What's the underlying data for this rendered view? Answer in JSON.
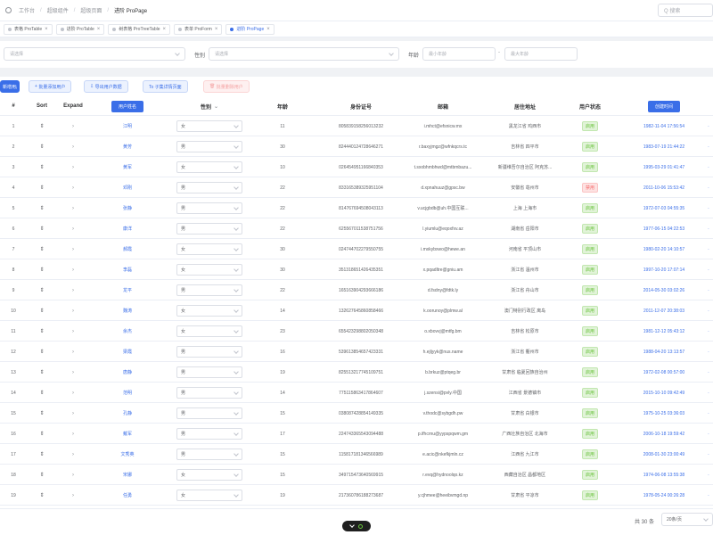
{
  "breadcrumb": {
    "items": [
      "工作台",
      "超级组件",
      "超级页面",
      "进阶 ProPage"
    ]
  },
  "search": {
    "placeholder": "Q 搜索"
  },
  "tabs": [
    {
      "label": "表格 ProTable",
      "active": false
    },
    {
      "label": "进阶 ProTable",
      "active": false
    },
    {
      "label": "树表格 ProTreeTable",
      "active": false
    },
    {
      "label": "表单 ProForm",
      "active": false
    },
    {
      "label": "进阶 ProPage",
      "active": true
    }
  ],
  "filter": {
    "f1_placeholder": "请选择",
    "gender_label": "性别",
    "gender_placeholder": "请选择",
    "age_label": "年龄",
    "age_min_placeholder": "最小年龄",
    "age_max_placeholder": "最大年龄"
  },
  "toolbar": {
    "add": "新增用户",
    "batch_add": "批量添加用户",
    "export": "导出用户数据",
    "detail": "To 子集详情页面",
    "batch_delete": "批量删除用户"
  },
  "table": {
    "headers": {
      "index": "#",
      "sort": "Sort",
      "expand": "Expand",
      "username": "用户姓名",
      "gender": "性别",
      "age": "年龄",
      "idcard": "身份证号",
      "email": "邮箱",
      "address": "居住地址",
      "status": "用户状态",
      "created": "创建时间"
    },
    "rows": [
      {
        "idx": "1",
        "name": "江明",
        "gender": "女",
        "age": "11",
        "id": "805839158256013232",
        "email": "i.mhct@efsnicw.mx",
        "addr": "黑龙江省 鸡西市",
        "status": "启用",
        "date": "1982-11-04 17:56:54"
      },
      {
        "idx": "2",
        "name": "黄芳",
        "gender": "男",
        "age": "30",
        "id": "824440124728646271",
        "email": "r.baxyjmgz@wfnkqcrs.tc",
        "addr": "吉林省 四平市",
        "status": "启用",
        "date": "1983-07-19 21:44:22"
      },
      {
        "idx": "3",
        "name": "黄军",
        "gender": "女",
        "age": "10",
        "id": "026454951166840353",
        "email": "t.sxobhmbhwd@mtbmbazu...",
        "addr": "新疆维吾尔自治区 阿克苏...",
        "status": "启用",
        "date": "1995-03-29 01:41:47"
      },
      {
        "idx": "4",
        "name": "邓刚",
        "gender": "男",
        "age": "22",
        "id": "833165389325951104",
        "email": "d.xpnahuuz@gpsc.bw",
        "addr": "安徽省 亳州市",
        "status": "禁用",
        "date": "2011-10-06 15:53:42"
      },
      {
        "idx": "5",
        "name": "张静",
        "gender": "男",
        "age": "22",
        "id": "814767694508043113",
        "email": "v.ucjgbdb@uh.中国互联...",
        "addr": "上海 上海市",
        "status": "启用",
        "date": "1972-07-03 04:55:35"
      },
      {
        "idx": "6",
        "name": "康洋",
        "gender": "男",
        "age": "22",
        "id": "625567011538751756",
        "email": "l.yiumlu@eqoxfxv.az",
        "addr": "湖南省 岳阳市",
        "status": "启用",
        "date": "1977-06-15 04:22:53"
      },
      {
        "idx": "7",
        "name": "郝霞",
        "gender": "女",
        "age": "30",
        "id": "024744702279550755",
        "email": "i.mxkybxwo@hewe.an",
        "addr": "河南省 平顶山市",
        "status": "启用",
        "date": "1980-02-20 14:10:57"
      },
      {
        "idx": "8",
        "name": "李磊",
        "gender": "女",
        "age": "30",
        "id": "351318651426435351",
        "email": "x.pqadltre@gniu.am",
        "addr": "浙江省 温州市",
        "status": "启用",
        "date": "1997-10-20 17:07:14"
      },
      {
        "idx": "9",
        "name": "龙平",
        "gender": "男",
        "age": "22",
        "id": "165163904293666186",
        "email": "d.fsdny@fdtk.ly",
        "addr": "浙江省 舟山市",
        "status": "启用",
        "date": "2014-05-30 03:02:26"
      },
      {
        "idx": "10",
        "name": "魏涛",
        "gender": "女",
        "age": "14",
        "id": "132627645860858466",
        "email": "k.oorunoy@plmw.al",
        "addr": "澳门特别行政区 离岛",
        "status": "启用",
        "date": "2011-12-07 20:38:03"
      },
      {
        "idx": "11",
        "name": "余杰",
        "gender": "女",
        "age": "23",
        "id": "655423298802050348",
        "email": "o.xbovvj@mtfg.bm",
        "addr": "吉林省 松原市",
        "status": "启用",
        "date": "1981-12-12 05:43:12"
      },
      {
        "idx": "12",
        "name": "梁霞",
        "gender": "男",
        "age": "16",
        "id": "539613854657423331",
        "email": "h.ejljyyk@nus.name",
        "addr": "浙江省 衢州市",
        "status": "启用",
        "date": "1988-04-20 13:13:57"
      },
      {
        "idx": "13",
        "name": "唐静",
        "gender": "男",
        "age": "19",
        "id": "825513217745109751",
        "email": "b.brkuz@ptqeg.br",
        "addr": "甘肃省 临夏回族自治州",
        "status": "启用",
        "date": "1972-02-08 00:57:00"
      },
      {
        "idx": "14",
        "name": "范明",
        "gender": "男",
        "age": "14",
        "id": "775115863417864607",
        "email": "j.szensi@pvly.中国",
        "addr": "江西省 景德镇市",
        "status": "启用",
        "date": "2015-10-10 09:42:49"
      },
      {
        "idx": "15",
        "name": "孔静",
        "gender": "男",
        "age": "15",
        "id": "038087428854149335",
        "email": "v.thodc@sybgdh.pw",
        "addr": "甘肃省 白银市",
        "status": "启用",
        "date": "1975-10-25 03:36:03"
      },
      {
        "idx": "16",
        "name": "戴军",
        "gender": "男",
        "age": "17",
        "id": "224743365543094488",
        "email": "p.ifhcrnu@yypspqwm.gm",
        "addr": "广西壮族自治区 北海市",
        "status": "启用",
        "date": "2006-10-18 19:59:42"
      },
      {
        "idx": "17",
        "name": "文秀英",
        "gender": "男",
        "age": "15",
        "id": "115817181346566989",
        "email": "e.acic@nkefkjmln.cz",
        "addr": "江西省 九江市",
        "status": "启用",
        "date": "2008-01-30 23:00:49"
      },
      {
        "idx": "18",
        "name": "宋娜",
        "gender": "女",
        "age": "15",
        "id": "349715473640569915",
        "email": "r.evq@hydnoolqo.kz",
        "addr": "西藏自治区 昌都地区",
        "status": "启用",
        "date": "1974-06-08 13:55:38"
      },
      {
        "idx": "19",
        "name": "任勇",
        "gender": "女",
        "age": "19",
        "id": "217360786188273687",
        "email": "y.cjhmee@heeibvmgd.np",
        "addr": "甘肃省 平凉市",
        "status": "启用",
        "date": "1978-05-24 00:26:28"
      },
      {
        "idx": "20",
        "name": "汪秀兰",
        "gender": "男",
        "age": "24",
        "id": "698451214173211557",
        "email": "w.tfbo@sctkwvd.km",
        "addr": "安徽省 宿州市",
        "status": "启用",
        "date": "1989-08-12 12:23:07"
      }
    ]
  },
  "pagination": {
    "total": "共 30 条",
    "page_size": "20条/页"
  },
  "colors": {
    "accent": "#3a6ee8",
    "enabled": "#67c23a",
    "disabled": "#f56c6c"
  }
}
